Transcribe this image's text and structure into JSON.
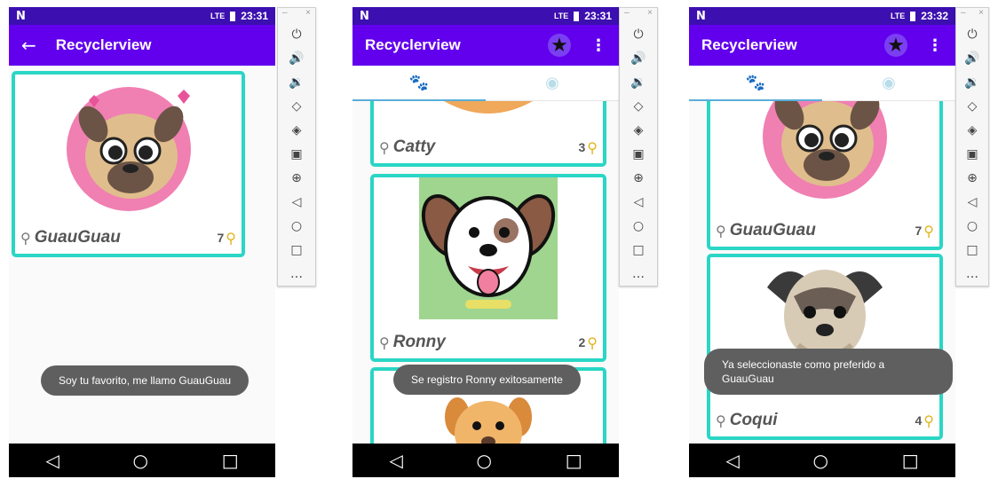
{
  "status_bar": {
    "carrier": "N",
    "signal": "LTE",
    "phone1_time": "23:31",
    "phone2_time": "23:31",
    "phone3_time": "23:32"
  },
  "app": {
    "title": "Recyclerview",
    "back_icon": "arrow-left-icon",
    "fav_icon": "star-icon",
    "menu_icon": "more-vert-icon"
  },
  "tabs": [
    {
      "icon": "paw-icon"
    },
    {
      "icon": "dog-face-icon"
    }
  ],
  "phone1": {
    "cards": [
      {
        "name": "GuauGuau",
        "likes": "7"
      }
    ],
    "toast": "Soy tu favorito, me llamo GuauGuau"
  },
  "phone2": {
    "cards": [
      {
        "name": "Catty",
        "likes": "3"
      },
      {
        "name": "Ronny",
        "likes": "2"
      }
    ],
    "toast": "Se registro Ronny exitosamente"
  },
  "phone3": {
    "cards": [
      {
        "name": "GuauGuau",
        "likes": "7"
      },
      {
        "name": "Coqui",
        "likes": "4"
      }
    ],
    "toast": "Ya seleccionaste como preferido a GuauGuau"
  },
  "emulator_controls": [
    "power-icon",
    "volume-up-icon",
    "volume-down-icon",
    "rotate-left-icon",
    "rotate-right-icon",
    "camera-icon",
    "zoom-in-icon",
    "back-icon",
    "home-icon",
    "overview-icon",
    "more-icon"
  ],
  "nav_icons": [
    "nav-back-icon",
    "nav-home-icon",
    "nav-recents-icon"
  ],
  "colors": {
    "status_bar": "#3c0fb0",
    "app_bar": "#6200ee",
    "card_border": "#2ad6c5",
    "tab_active": "#5aaed8",
    "toast": "#5f5f5f"
  }
}
